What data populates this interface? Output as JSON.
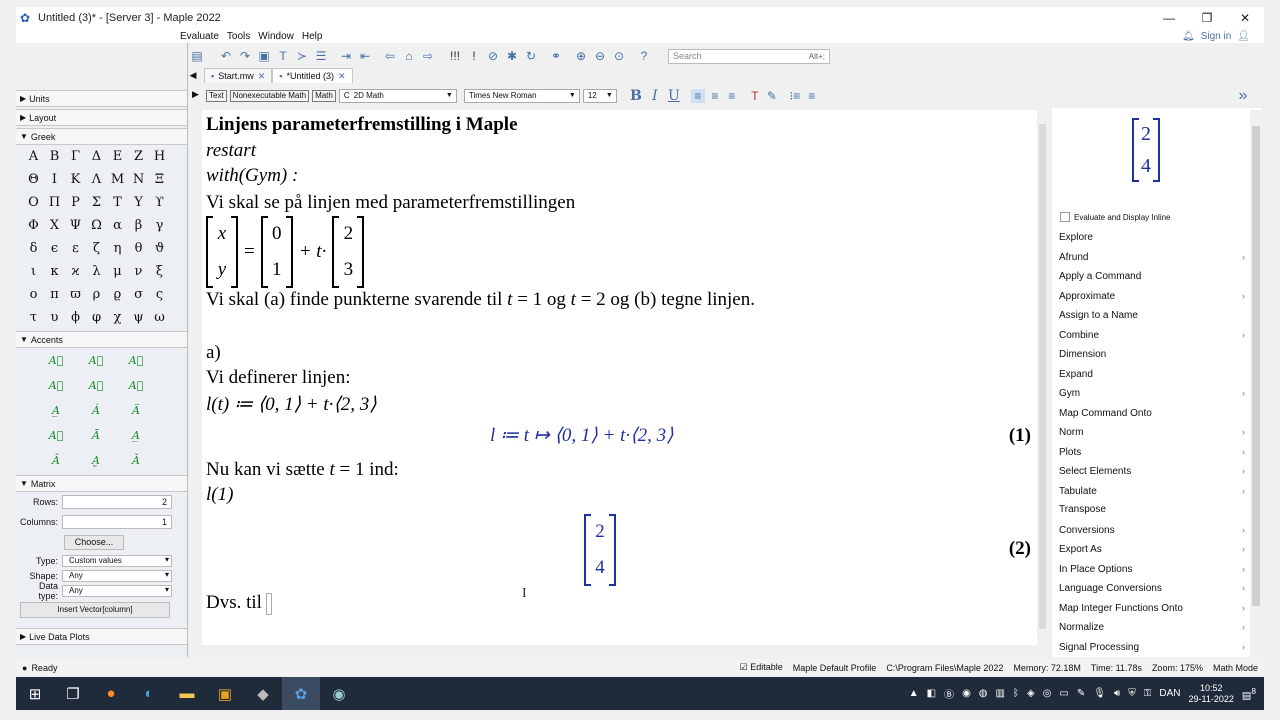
{
  "window": {
    "title": "Untitled (3)* - [Server 3] - Maple 2022",
    "controls": [
      "—",
      "❐",
      "✕"
    ]
  },
  "menu": {
    "items": [
      "Evaluate",
      "Tools",
      "Window",
      "Help"
    ],
    "sign_in": "Sign in"
  },
  "search": {
    "placeholder": "Search",
    "shortcut": "Alt+;"
  },
  "tabs": [
    {
      "label": "Start.mw"
    },
    {
      "label": "*Untitled (3)"
    }
  ],
  "format_bar": {
    "text_btn": "Text",
    "nonexec_btn": "Nonexecutable Math",
    "math_btn": "Math",
    "mode_select": "2D Math",
    "font_select": "Times New Roman",
    "size_select": "12",
    "bold": "B",
    "italic": "I",
    "underline": "U"
  },
  "palettes": {
    "units": "Units",
    "layout": "Layout",
    "greek": "Greek",
    "greek_letters": [
      "Α",
      "Β",
      "Γ",
      "Δ",
      "Ε",
      "Ζ",
      "Η",
      "Θ",
      "Ι",
      "Κ",
      "Λ",
      "Μ",
      "Ν",
      "Ξ",
      "Ο",
      "Π",
      "Ρ",
      "Σ",
      "Τ",
      "Υ",
      "ϒ",
      "Φ",
      "Χ",
      "Ψ",
      "Ω",
      "α",
      "β",
      "γ",
      "δ",
      "ϵ",
      "ε",
      "ζ",
      "η",
      "θ",
      "ϑ",
      "ι",
      "κ",
      "ϰ",
      "λ",
      "μ",
      "ν",
      "ξ",
      "ο",
      "π",
      "ϖ",
      "ρ",
      "ϱ",
      "σ",
      "ς",
      "τ",
      "υ",
      "ϕ",
      "φ",
      "χ",
      "ψ",
      "ω"
    ],
    "accents": "Accents",
    "accent_items": [
      "A⃖",
      "A⃗",
      "A⃡",
      "A⃐",
      "A⃑",
      "A⃗",
      "A̲",
      "Ȧ",
      "Ä",
      "A⃛",
      "Ā",
      "A̲",
      "Â",
      "A̰",
      "Ǎ"
    ],
    "matrix": "Matrix",
    "matrix_rows_label": "Rows:",
    "matrix_rows": "2",
    "matrix_cols_label": "Columns:",
    "matrix_cols": "1",
    "choose_btn": "Choose...",
    "type_label": "Type:",
    "type_value": "Custom values",
    "shape_label": "Shape:",
    "shape_value": "Any",
    "dtype_label": "Data type:",
    "dtype_value": "Any",
    "insert_btn": "Insert Vector[column]",
    "live_data": "Live Data Plots"
  },
  "document": {
    "heading": "Linjens parameterfremstilling i Maple",
    "restart": "restart",
    "with_cmd": "with(Gym) :",
    "intro": "Vi skal se på linjen med parameterfremstillingen",
    "matrix_xy": [
      "x",
      "y"
    ],
    "matrix_p0": [
      "0",
      "1"
    ],
    "matrix_dir": [
      "2",
      "3"
    ],
    "equals": "=",
    "plus_t": "+ t·",
    "task_pre": "Vi skal (a) finde punkterne svarende til ",
    "task_t1": "t",
    "task_mid1": " = 1 og ",
    "task_t2": "t",
    "task_post": " = 2 og (b) tegne linjen.",
    "part_a": "a)",
    "define_text": "Vi definerer linjen:",
    "define_cmd": "l(t) ≔ ⟨0, 1⟩ + t·⟨2, 3⟩",
    "output1": "l ≔ t ↦ ⟨0, 1⟩ + t·⟨2, 3⟩",
    "label1": "(1)",
    "insert_pre": "Nu kan vi sætte ",
    "insert_t": "t",
    "insert_post": " = 1 ind:",
    "call_cmd": "l(1)",
    "output2_vec": [
      "2",
      "4"
    ],
    "label2": "(2)",
    "partial_text": "Dvs. til"
  },
  "context_panel": {
    "preview_vec": [
      "2",
      "4"
    ],
    "eval_inline": "Evaluate and Display Inline",
    "items": [
      {
        "label": "Explore",
        "arrow": ""
      },
      {
        "label": "Afrund",
        "arrow": "›"
      },
      {
        "label": "Apply a Command",
        "arrow": ""
      },
      {
        "label": "Approximate",
        "arrow": "›"
      },
      {
        "label": "Assign to a Name",
        "arrow": ""
      },
      {
        "label": "Combine",
        "arrow": "›"
      },
      {
        "label": "Dimension",
        "arrow": ""
      },
      {
        "label": "Expand",
        "arrow": ""
      },
      {
        "label": "Gym",
        "arrow": "›"
      },
      {
        "label": "Map Command Onto",
        "arrow": ""
      },
      {
        "label": "Norm",
        "arrow": "›"
      },
      {
        "label": "Plots",
        "arrow": "›"
      },
      {
        "label": "Select Elements",
        "arrow": "›"
      },
      {
        "label": "Tabulate",
        "arrow": "›"
      },
      {
        "label": "Transpose",
        "arrow": ""
      },
      {
        "label": "Conversions",
        "arrow": "›"
      },
      {
        "label": "Export As",
        "arrow": "›"
      },
      {
        "label": "In Place Options",
        "arrow": "›"
      },
      {
        "label": "Language Conversions",
        "arrow": "›"
      },
      {
        "label": "Map Integer Functions Onto",
        "arrow": "›"
      },
      {
        "label": "Normalize",
        "arrow": "›"
      },
      {
        "label": "Signal Processing",
        "arrow": "›"
      }
    ]
  },
  "status": {
    "ready": "Ready",
    "editable": "Editable",
    "profile": "Maple Default Profile",
    "path": "C:\\Program Files\\Maple 2022",
    "memory": "Memory: 72.18M",
    "time": "Time: 11.78s",
    "zoom": "Zoom: 175%",
    "mode": "Math Mode"
  },
  "taskbar": {
    "lang": "DAN",
    "time": "10:52",
    "date": "29-11-2022",
    "notif_count": "8"
  }
}
